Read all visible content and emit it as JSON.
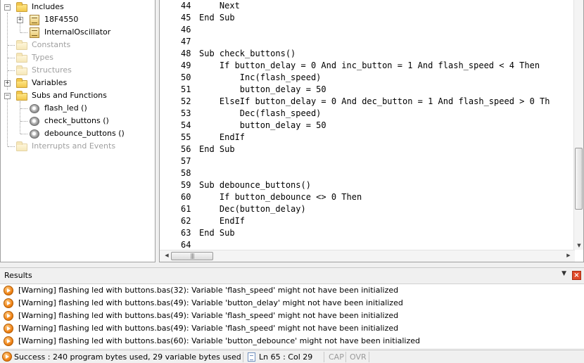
{
  "tree": {
    "items": [
      {
        "label": "Includes",
        "expander": "−",
        "icon": "folder-icon",
        "dim": false
      },
      {
        "label": "18F4550",
        "expander": "+",
        "icon": "module-icon",
        "dim": false
      },
      {
        "label": "InternalOscillator",
        "expander": "",
        "icon": "module-icon",
        "dim": false
      },
      {
        "label": "Constants",
        "expander": "",
        "icon": "folder-icon",
        "dim": true
      },
      {
        "label": "Types",
        "expander": "",
        "icon": "folder-icon",
        "dim": true
      },
      {
        "label": "Structures",
        "expander": "",
        "icon": "folder-icon",
        "dim": true
      },
      {
        "label": "Variables",
        "expander": "+",
        "icon": "folder-icon",
        "dim": false
      },
      {
        "label": "Subs and Functions",
        "expander": "−",
        "icon": "folder-icon",
        "dim": false
      },
      {
        "label": "flash_led ()",
        "expander": "",
        "icon": "sub-icon",
        "dim": false
      },
      {
        "label": "check_buttons ()",
        "expander": "",
        "icon": "sub-icon",
        "dim": false
      },
      {
        "label": "debounce_buttons ()",
        "expander": "",
        "icon": "sub-icon",
        "dim": false
      },
      {
        "label": "Interrupts and Events",
        "expander": "",
        "icon": "folder-icon",
        "dim": true
      }
    ]
  },
  "editor": {
    "lines": [
      {
        "num": "44",
        "text": "    Next"
      },
      {
        "num": "45",
        "text": "End Sub"
      },
      {
        "num": "46",
        "text": ""
      },
      {
        "num": "47",
        "text": ""
      },
      {
        "num": "48",
        "text": "Sub check_buttons()"
      },
      {
        "num": "49",
        "text": "    If button_delay = 0 And inc_button = 1 And flash_speed < 4 Then"
      },
      {
        "num": "50",
        "text": "        Inc(flash_speed)"
      },
      {
        "num": "51",
        "text": "        button_delay = 50"
      },
      {
        "num": "52",
        "text": "    ElseIf button_delay = 0 And dec_button = 1 And flash_speed > 0 Th"
      },
      {
        "num": "53",
        "text": "        Dec(flash_speed)"
      },
      {
        "num": "54",
        "text": "        button_delay = 50"
      },
      {
        "num": "55",
        "text": "    EndIf"
      },
      {
        "num": "56",
        "text": "End Sub"
      },
      {
        "num": "57",
        "text": ""
      },
      {
        "num": "58",
        "text": ""
      },
      {
        "num": "59",
        "text": "Sub debounce_buttons()"
      },
      {
        "num": "60",
        "text": "    If button_debounce <> 0 Then"
      },
      {
        "num": "61",
        "text": "    Dec(button_delay)"
      },
      {
        "num": "62",
        "text": "    EndIf"
      },
      {
        "num": "63",
        "text": "End Sub"
      },
      {
        "num": "64",
        "text": ""
      }
    ]
  },
  "results": {
    "title": "Results",
    "menu_glyph": "▼",
    "close_glyph": "×",
    "rows": [
      "[Warning] flashing led with buttons.bas(32): Variable 'flash_speed' might not have been initialized",
      "[Warning] flashing led with buttons.bas(49): Variable 'button_delay' might not have been initialized",
      "[Warning] flashing led with buttons.bas(49): Variable 'flash_speed' might not have been initialized",
      "[Warning] flashing led with buttons.bas(49): Variable 'flash_speed' might not have been initialized",
      "[Warning] flashing led with buttons.bas(60): Variable 'button_debounce' might not have been initialized"
    ]
  },
  "status": {
    "message": "Success : 240 program bytes used, 29 variable bytes used",
    "position": "Ln 65 : Col 29",
    "cap": "CAP",
    "ovr": "OVR"
  }
}
